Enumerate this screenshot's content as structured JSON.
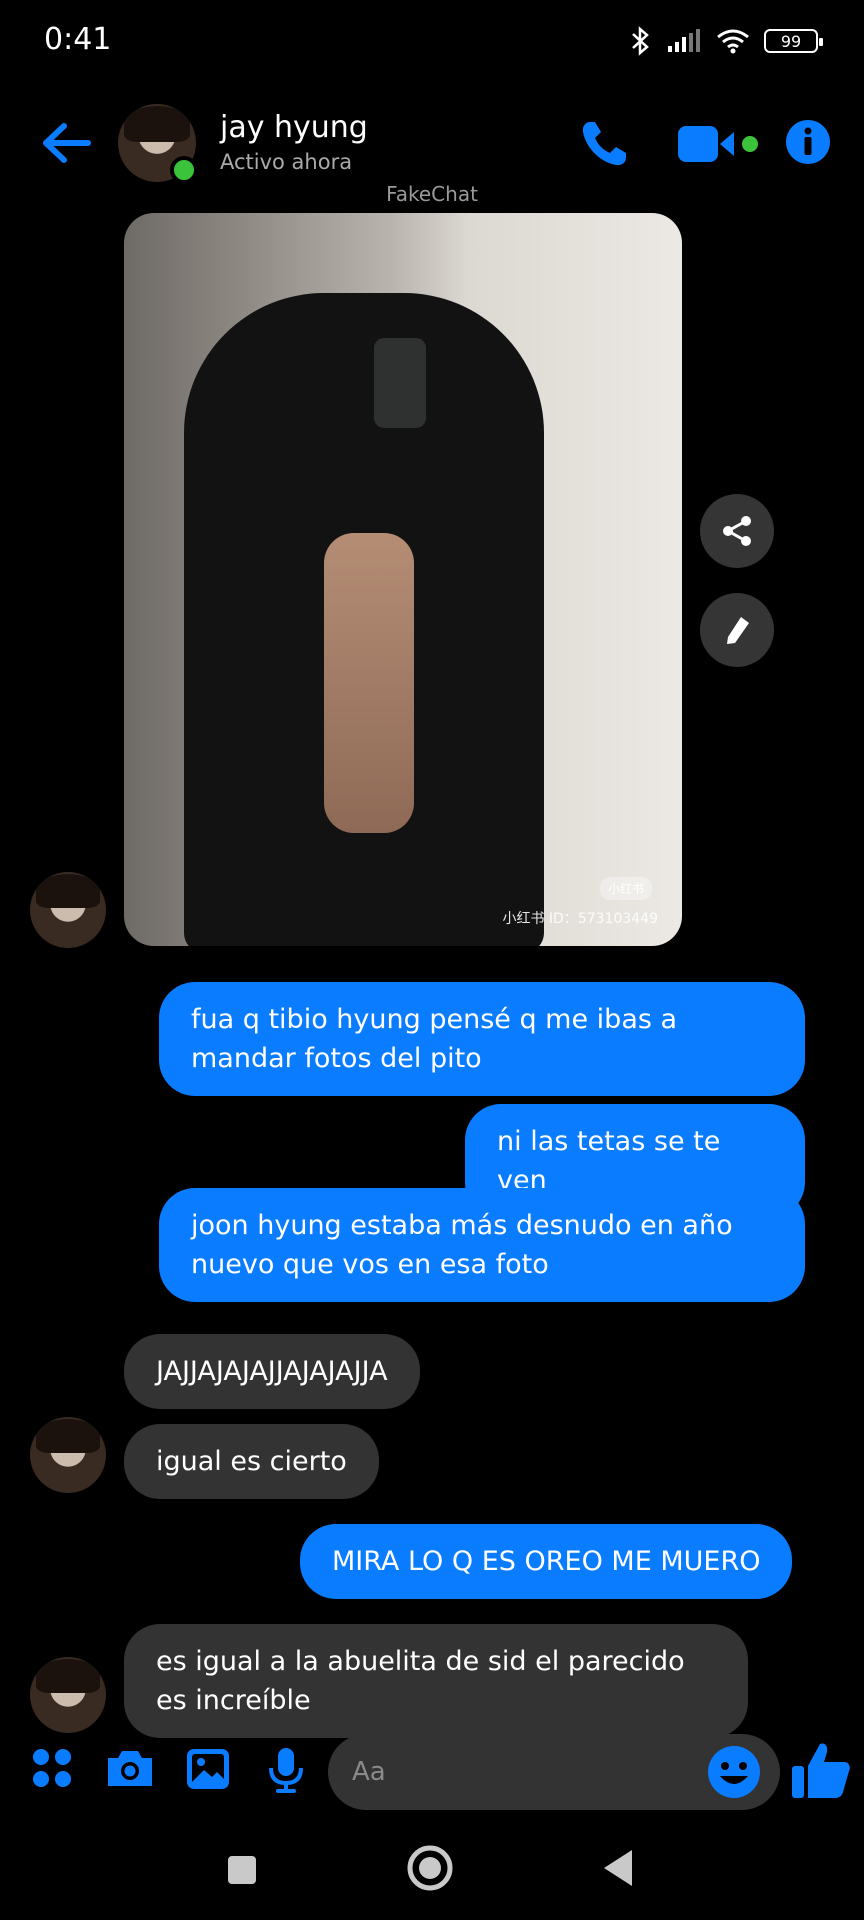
{
  "status": {
    "time": "0:41",
    "battery": "99"
  },
  "header": {
    "name": "jay hyung",
    "subtitle": "Activo ahora"
  },
  "watermark": "FakeChat",
  "photo": {
    "caption": "小红书 ID：573103449",
    "tag": "小红书"
  },
  "messages": [
    {
      "type": "sent",
      "text": "fua q tibio hyung pensé q me ibas a mandar fotos del pito"
    },
    {
      "type": "sent",
      "text": "ni las tetas se te ven"
    },
    {
      "type": "sent",
      "text": "joon hyung estaba más desnudo en año nuevo que vos en esa foto"
    },
    {
      "type": "received",
      "text": "JAJJAJAJAJJAJAJAJJA"
    },
    {
      "type": "received",
      "text": "igual es cierto"
    },
    {
      "type": "sent",
      "text": "MIRA LO Q ES OREO ME MUERO"
    },
    {
      "type": "received",
      "text": "es igual a la abuelita de sid el parecido es increíble"
    }
  ],
  "composer": {
    "placeholder": "Aa"
  },
  "colors": {
    "accent": "#0a7cff",
    "received_bubble": "#333333",
    "online": "#3cc33c"
  },
  "icons": [
    "back-arrow-icon",
    "phone-icon",
    "video-icon",
    "info-icon",
    "share-icon",
    "edit-icon",
    "apps-icon",
    "camera-icon",
    "gallery-icon",
    "mic-icon",
    "emoji-icon",
    "like-icon"
  ]
}
